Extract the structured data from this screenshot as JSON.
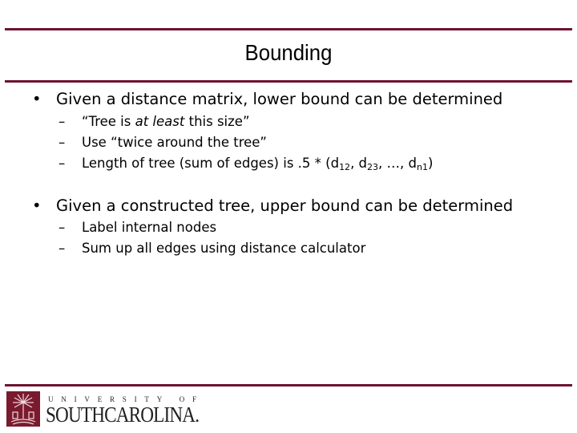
{
  "slide": {
    "title": "Bounding",
    "bullets": [
      {
        "text": "Given a distance matrix, lower bound can be determined",
        "sub": [
          {
            "pre": "“Tree is ",
            "em": "at least",
            "post": " this size”"
          },
          {
            "text": "Use “twice around the tree”"
          },
          {
            "pre": "Length of tree (sum of edges) is .5 * (d",
            "s1": "12",
            "m1": ", d",
            "s2": "23",
            "m2": ", …, d",
            "s3": "n1",
            "end": ")"
          }
        ]
      },
      {
        "text": "Given a constructed tree, upper bound can be determined",
        "sub": [
          {
            "text": "Label internal nodes"
          },
          {
            "text": "Sum up all edges using distance calculator"
          }
        ]
      }
    ],
    "bullet_glyph": "•",
    "dash_glyph": "–"
  },
  "footer": {
    "university_line1": "UNIVERSITY OF",
    "university_line2": "SOUTHCAROLINA.",
    "logo_icon": "palmetto-tree-icon"
  },
  "colors": {
    "accent": "#6e1330",
    "logo_bg": "#7a1a2e"
  }
}
